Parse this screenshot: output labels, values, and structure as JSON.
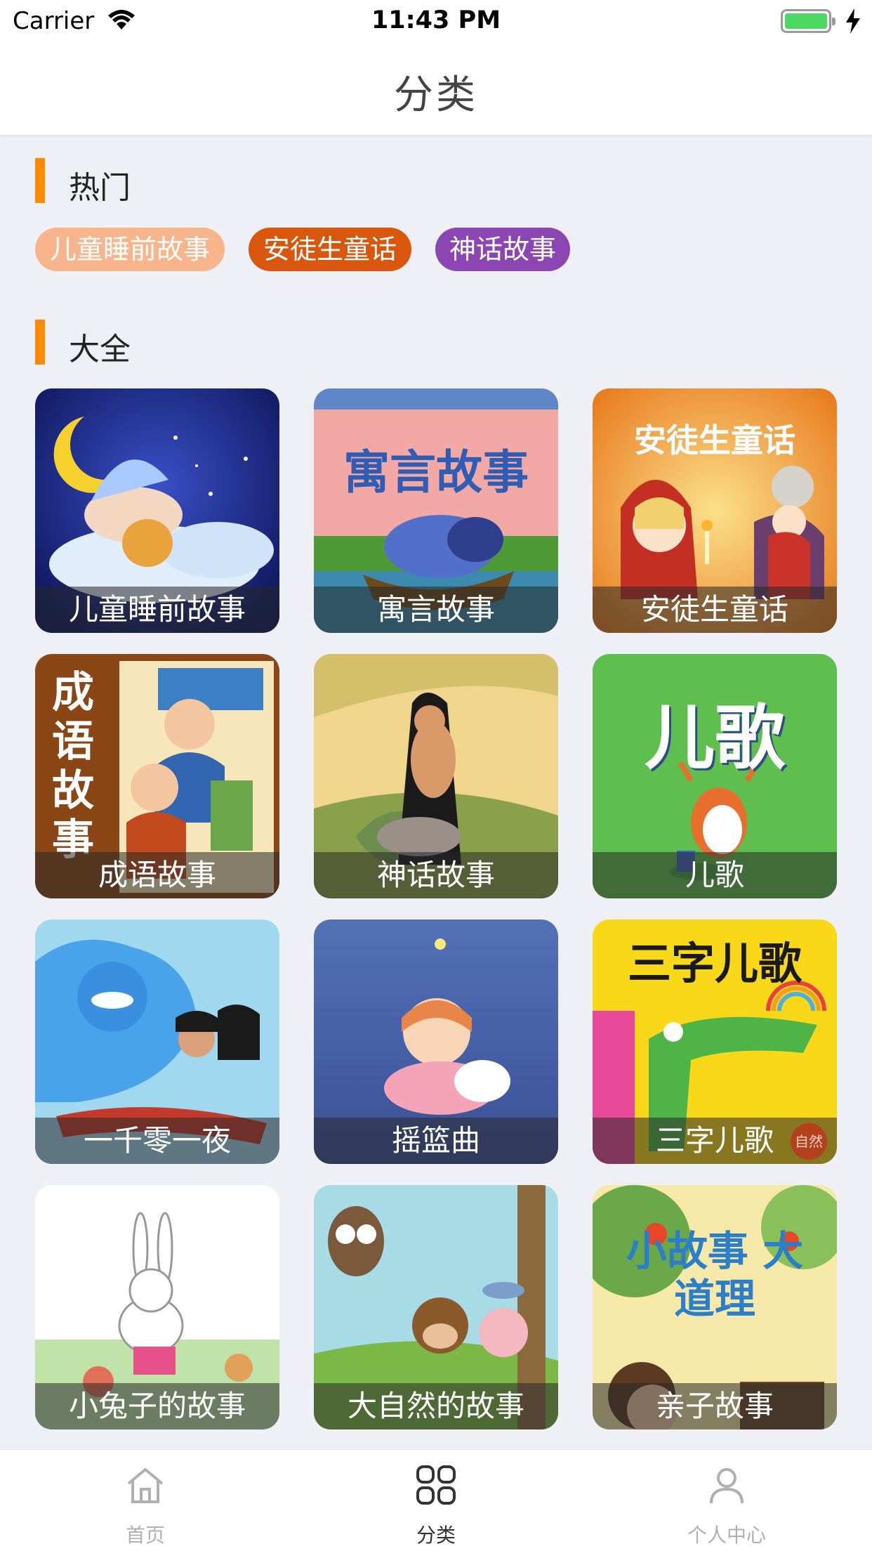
{
  "status_bar": {
    "carrier": "Carrier",
    "time": "11:43 PM"
  },
  "nav": {
    "title": "分类"
  },
  "sections": {
    "hot": "热门",
    "all": "大全"
  },
  "hot_tags": [
    {
      "label": "儿童睡前故事",
      "color": "#f8b48a"
    },
    {
      "label": "安徒生童话",
      "color": "#d9560d"
    },
    {
      "label": "神话故事",
      "color": "#8c46b3"
    }
  ],
  "categories": [
    {
      "label": "儿童睡前故事",
      "icon": "baby-sleeping-moon"
    },
    {
      "label": "寓言故事",
      "icon": "elephant-boat",
      "cover_title": "寓言故事"
    },
    {
      "label": "安徒生童话",
      "icon": "little-match-girl",
      "cover_title": "安徒生童话"
    },
    {
      "label": "成语故事",
      "icon": "ancient-scholars",
      "cover_title": "成语故事"
    },
    {
      "label": "神话故事",
      "icon": "long-haired-woman"
    },
    {
      "label": "儿歌",
      "icon": "cartoon-cow",
      "cover_title": "儿歌"
    },
    {
      "label": "一千零一夜",
      "icon": "genie-aladdin"
    },
    {
      "label": "摇篮曲",
      "icon": "girl-sleeping-moon"
    },
    {
      "label": "三字儿歌",
      "icon": "green-crocodile",
      "cover_title": "三字儿歌",
      "badge": "自然"
    },
    {
      "label": "小兔子的故事",
      "icon": "white-rabbit"
    },
    {
      "label": "大自然的故事",
      "icon": "owl-monkey-pig"
    },
    {
      "label": "亲子故事",
      "icon": "boy-apple-tree",
      "cover_title": "小故事 大道理"
    }
  ],
  "tabbar": [
    {
      "label": "首页",
      "icon": "home-icon",
      "active": false
    },
    {
      "label": "分类",
      "icon": "grid-icon",
      "active": true
    },
    {
      "label": "个人中心",
      "icon": "person-icon",
      "active": false
    }
  ],
  "colors": {
    "accent": "#ff8a00",
    "background": "#eff0f5",
    "battery": "#4cd964"
  }
}
